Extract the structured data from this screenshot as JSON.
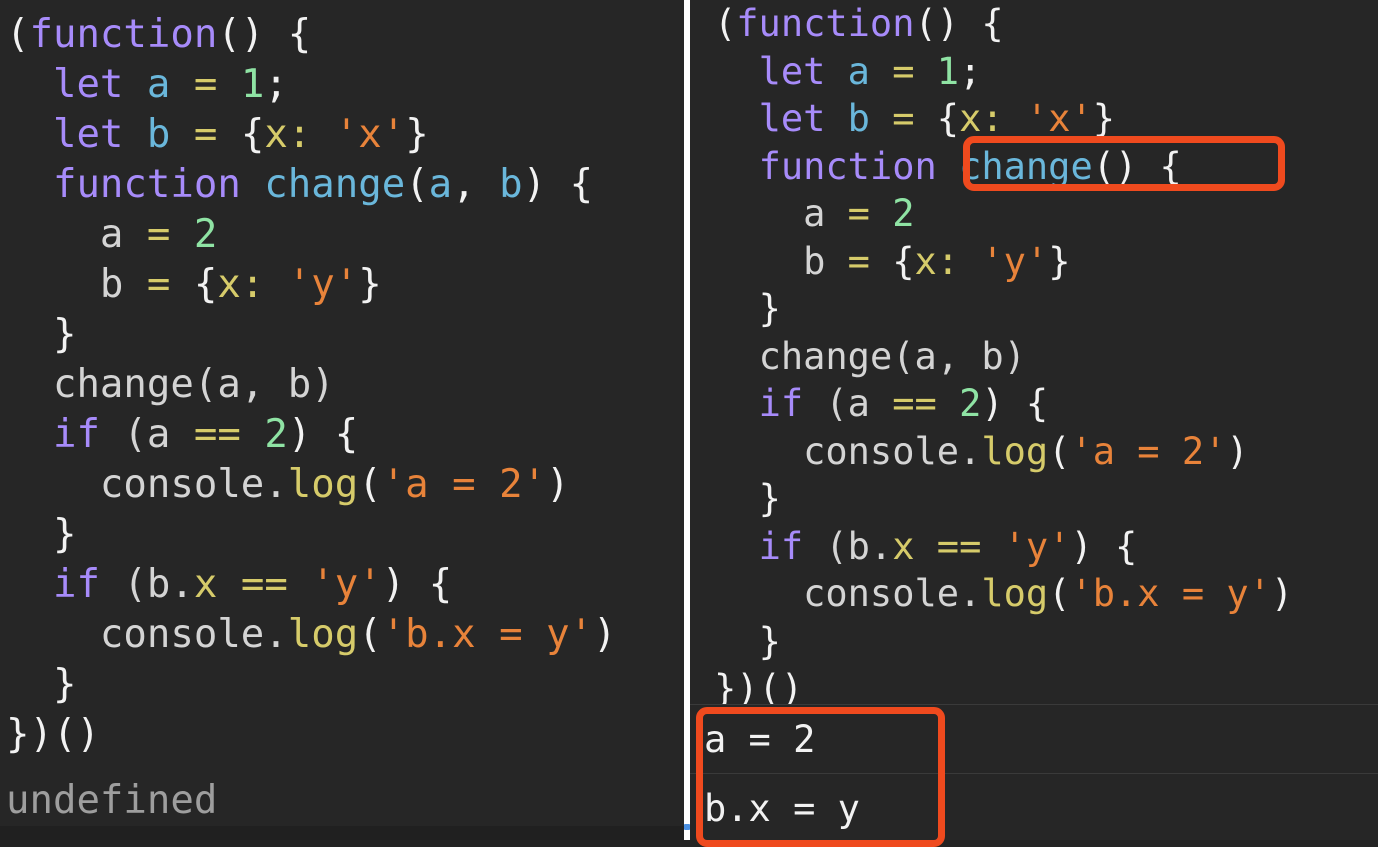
{
  "theme": {
    "background": "#262626",
    "divider": "#ffffff",
    "highlight": "#ef4a1e",
    "keyword": "#a78bfa",
    "identifier": "#6ab7db",
    "operator": "#d6cb6a",
    "number": "#8fe3a4",
    "string": "#e8833a",
    "punctuation": "#f2f2f2",
    "plain": "#d4d4d4",
    "result_text": "#9e9e9e",
    "console_text": "#f2f2f2"
  },
  "left_panel": {
    "name": "console-snippet-before",
    "code_lines": [
      "(function() {",
      "  let a = 1;",
      "  let b = {x: 'x'}",
      "  function change(a, b) {",
      "    a = 2",
      "    b = {x: 'y'}",
      "  }",
      "  change(a, b)",
      "  if (a == 2) {",
      "    console.log('a = 2')",
      "  }",
      "  if (b.x == 'y') {",
      "    console.log('b.x = y')",
      "  }",
      "})()"
    ],
    "result_value": "undefined"
  },
  "right_panel": {
    "name": "console-snippet-after",
    "code_lines": [
      "(function() {",
      "  let a = 1;",
      "  let b = {x: 'x'}",
      "  function change() {",
      "    a = 2",
      "    b = {x: 'y'}",
      "  }",
      "  change(a, b)",
      "  if (a == 2) {",
      "    console.log('a = 2')",
      "  }",
      "  if (b.x == 'y') {",
      "    console.log('b.x = y')",
      "  }",
      "})()"
    ],
    "console_output": [
      "a = 2",
      "b.x = y"
    ],
    "annotations": [
      {
        "label": "change() {",
        "target": "function-signature"
      },
      {
        "label": "a = 2 / b.x = y",
        "target": "console-output-block"
      }
    ]
  }
}
